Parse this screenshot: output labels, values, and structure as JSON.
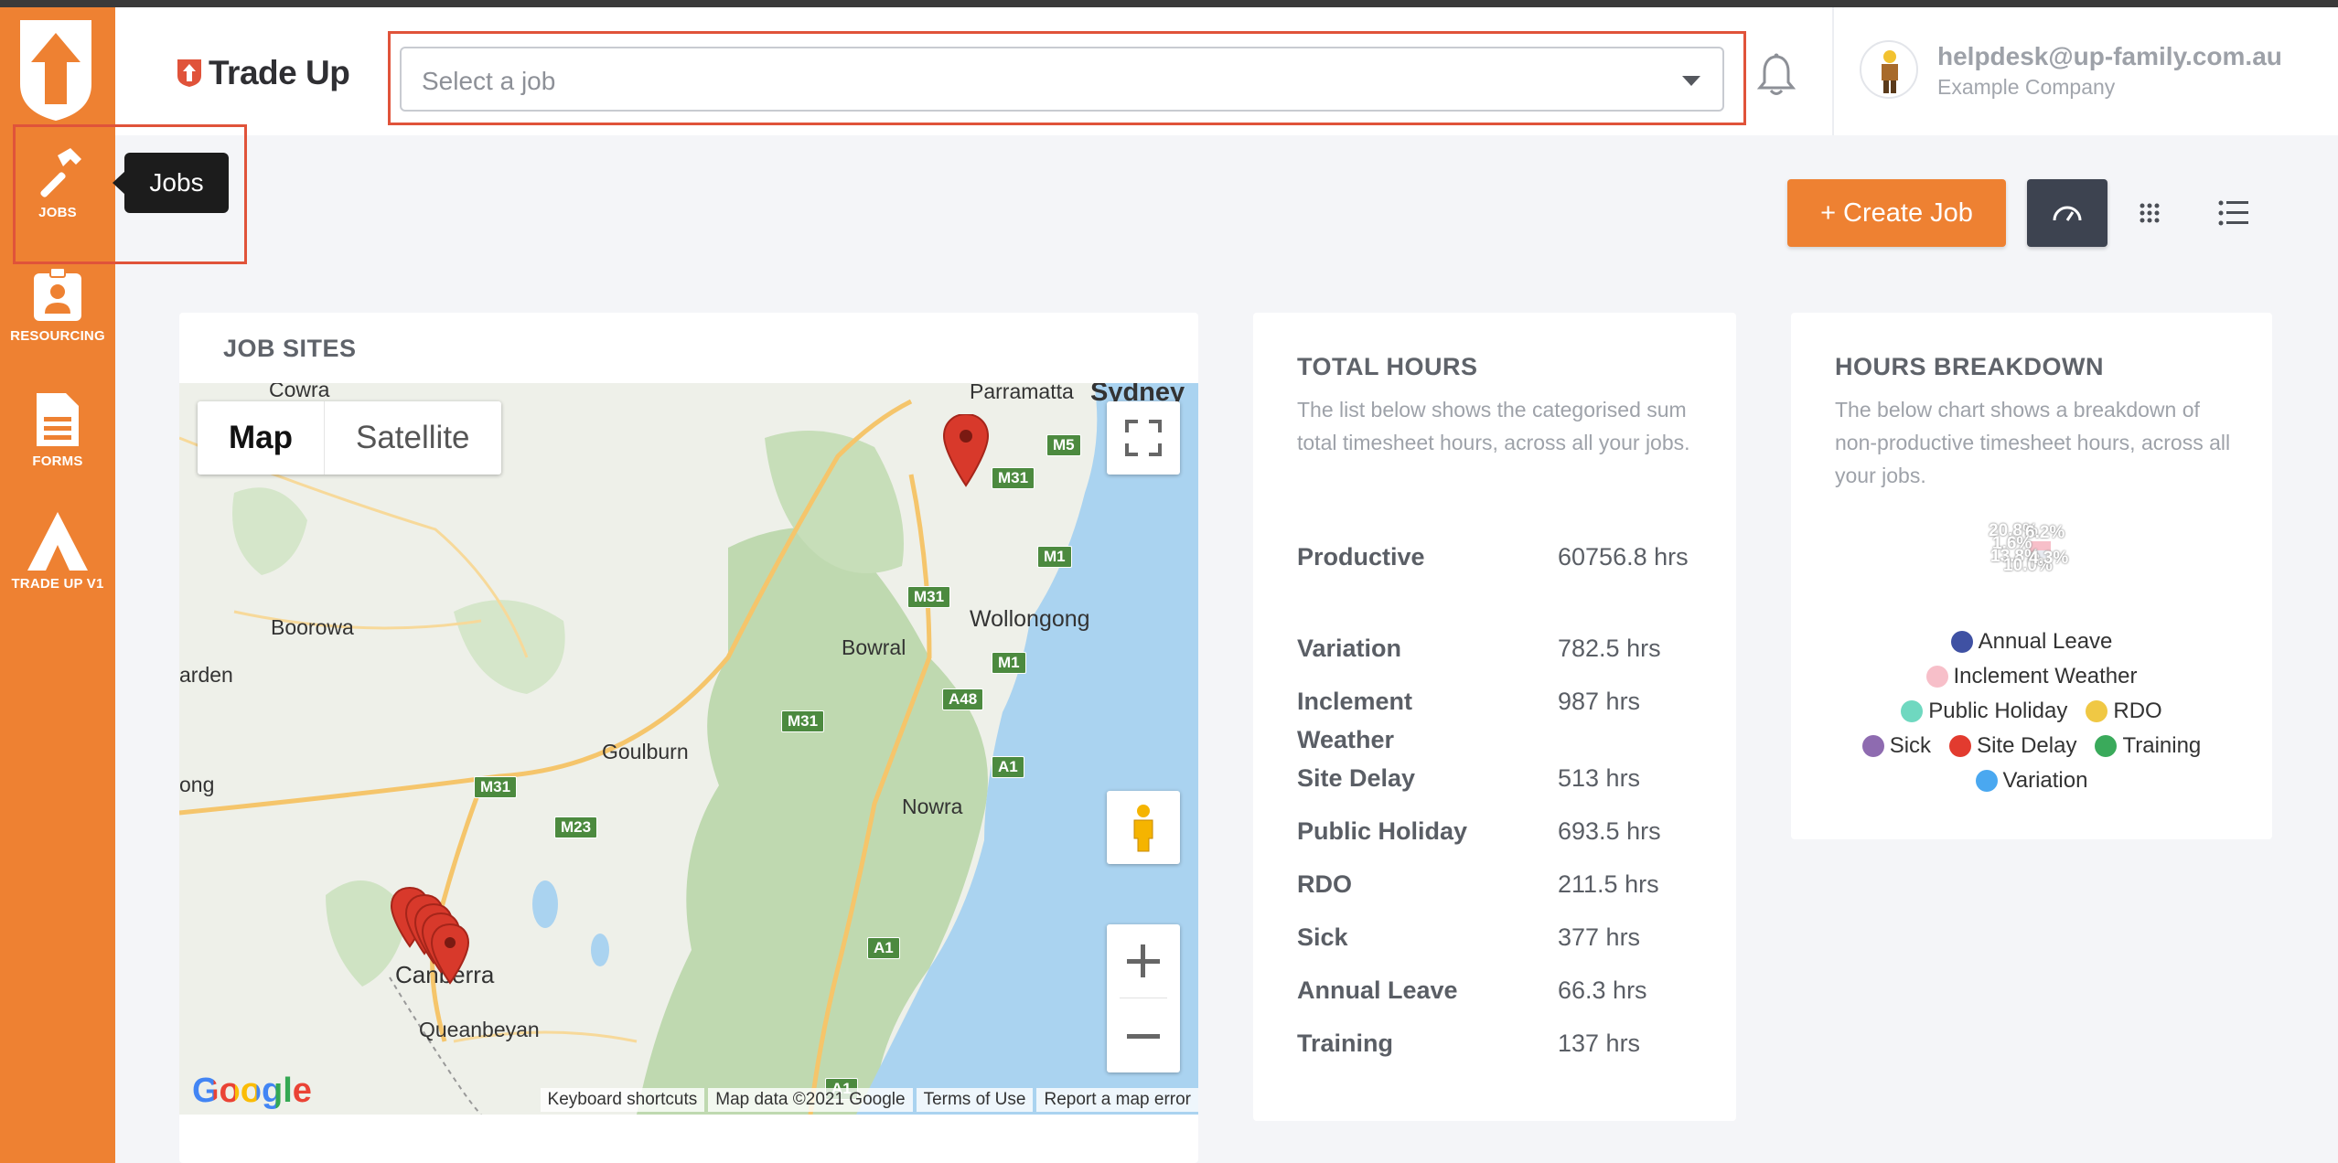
{
  "sidebar": {
    "items": [
      {
        "label": "JOBS",
        "icon": "hammer-icon"
      },
      {
        "label": "RESOURCING",
        "icon": "id-badge-icon"
      },
      {
        "label": "FORMS",
        "icon": "document-icon"
      },
      {
        "label": "TRADE UP V1",
        "icon": "trade-up-a-icon"
      }
    ]
  },
  "brand": {
    "name": "Trade Up"
  },
  "header": {
    "job_select_placeholder": "Select a job",
    "user_email": "helpdesk@up-family.com.au",
    "company": "Example Company"
  },
  "tooltip": {
    "text": "Jobs"
  },
  "toolbar": {
    "create_label": "+ Create Job"
  },
  "job_sites": {
    "title": "JOB SITES",
    "map": {
      "tab_map": "Map",
      "tab_satellite": "Satellite",
      "places": [
        "Cowra",
        "Parramatta",
        "Sydney",
        "Boorowa",
        "Wollongong",
        "Bowral",
        "arden",
        "Goulburn",
        "ong",
        "Nowra",
        "Canberra",
        "Queanbeyan"
      ],
      "roads": [
        "M31",
        "M5",
        "M1",
        "M31",
        "A48",
        "M1",
        "M31",
        "M31",
        "A1",
        "M23",
        "A1",
        "A1"
      ],
      "footer": [
        "Keyboard shortcuts",
        "Map data ©2021 Google",
        "Terms of Use",
        "Report a map error"
      ],
      "google": "Google"
    }
  },
  "total_hours": {
    "title": "TOTAL HOURS",
    "description": "The list below shows the categorised sum total timesheet hours, across all your jobs.",
    "rows": [
      {
        "label": "Productive",
        "value": "60756.8 hrs"
      },
      {
        "label": "Variation",
        "value": "782.5 hrs"
      },
      {
        "label": "Inclement Weather",
        "value": "987 hrs"
      },
      {
        "label": "Site Delay",
        "value": "513 hrs"
      },
      {
        "label": "Public Holiday",
        "value": "693.5 hrs"
      },
      {
        "label": "RDO",
        "value": "211.5 hrs"
      },
      {
        "label": "Sick",
        "value": "377 hrs"
      },
      {
        "label": "Annual Leave",
        "value": "66.3 hrs"
      },
      {
        "label": "Training",
        "value": "137 hrs"
      }
    ]
  },
  "hours_breakdown": {
    "title": "HOURS BREAKDOWN",
    "description": "The below chart shows a breakdown of non-productive timesheet hours, across all your jobs.",
    "pie_labels": [
      "20.8%",
      "6.2%",
      "1.6%",
      "13.8%",
      "10.0%",
      "4.3%"
    ],
    "legend": [
      {
        "label": "Annual Leave",
        "color": "#3f51a3"
      },
      {
        "label": "Inclement Weather",
        "color": "#f7bfc9"
      },
      {
        "label": "Public Holiday",
        "color": "#6fd8c0"
      },
      {
        "label": "RDO",
        "color": "#f0c844"
      },
      {
        "label": "Sick",
        "color": "#8e6bb0"
      },
      {
        "label": "Site Delay",
        "color": "#e23b2f"
      },
      {
        "label": "Training",
        "color": "#3aaa5b"
      },
      {
        "label": "Variation",
        "color": "#4aa8f0"
      }
    ]
  }
}
